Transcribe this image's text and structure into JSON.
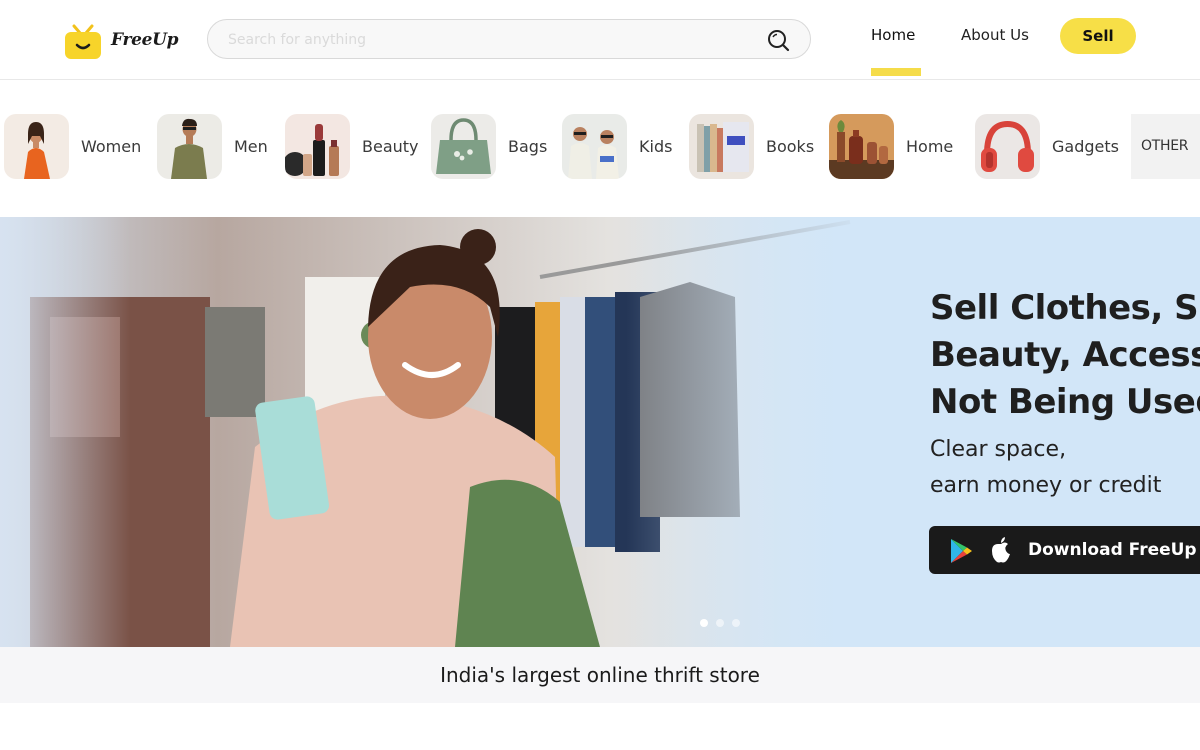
{
  "header": {
    "brand": "FreeUp",
    "search_placeholder": "Search for anything",
    "nav": {
      "home": "Home",
      "about": "About Us",
      "sell": "Sell"
    }
  },
  "categories": [
    {
      "label": "Women",
      "icon": "women-category-image"
    },
    {
      "label": "Men",
      "icon": "men-category-image"
    },
    {
      "label": "Beauty",
      "icon": "beauty-category-image"
    },
    {
      "label": "Bags",
      "icon": "bags-category-image"
    },
    {
      "label": "Kids",
      "icon": "kids-category-image"
    },
    {
      "label": "Books",
      "icon": "books-category-image"
    },
    {
      "label": "Home",
      "icon": "home-category-image"
    },
    {
      "label": "Gadgets",
      "icon": "gadgets-category-image"
    }
  ],
  "other_tile": "OTHER",
  "hero": {
    "heading_lines": [
      "Sell Clothes, Sh",
      "Beauty, Access",
      "Not Being Used"
    ],
    "sub_lines": [
      "Clear space,",
      "earn money or credit"
    ],
    "download_label": "Download FreeUp A",
    "slides_total": 3,
    "active_slide": 1
  },
  "tagline": "India's largest online thrift store",
  "colors": {
    "accent": "#f7df47",
    "hero_bg": "#d2e6f8",
    "button_dark": "#1a1a1a"
  }
}
